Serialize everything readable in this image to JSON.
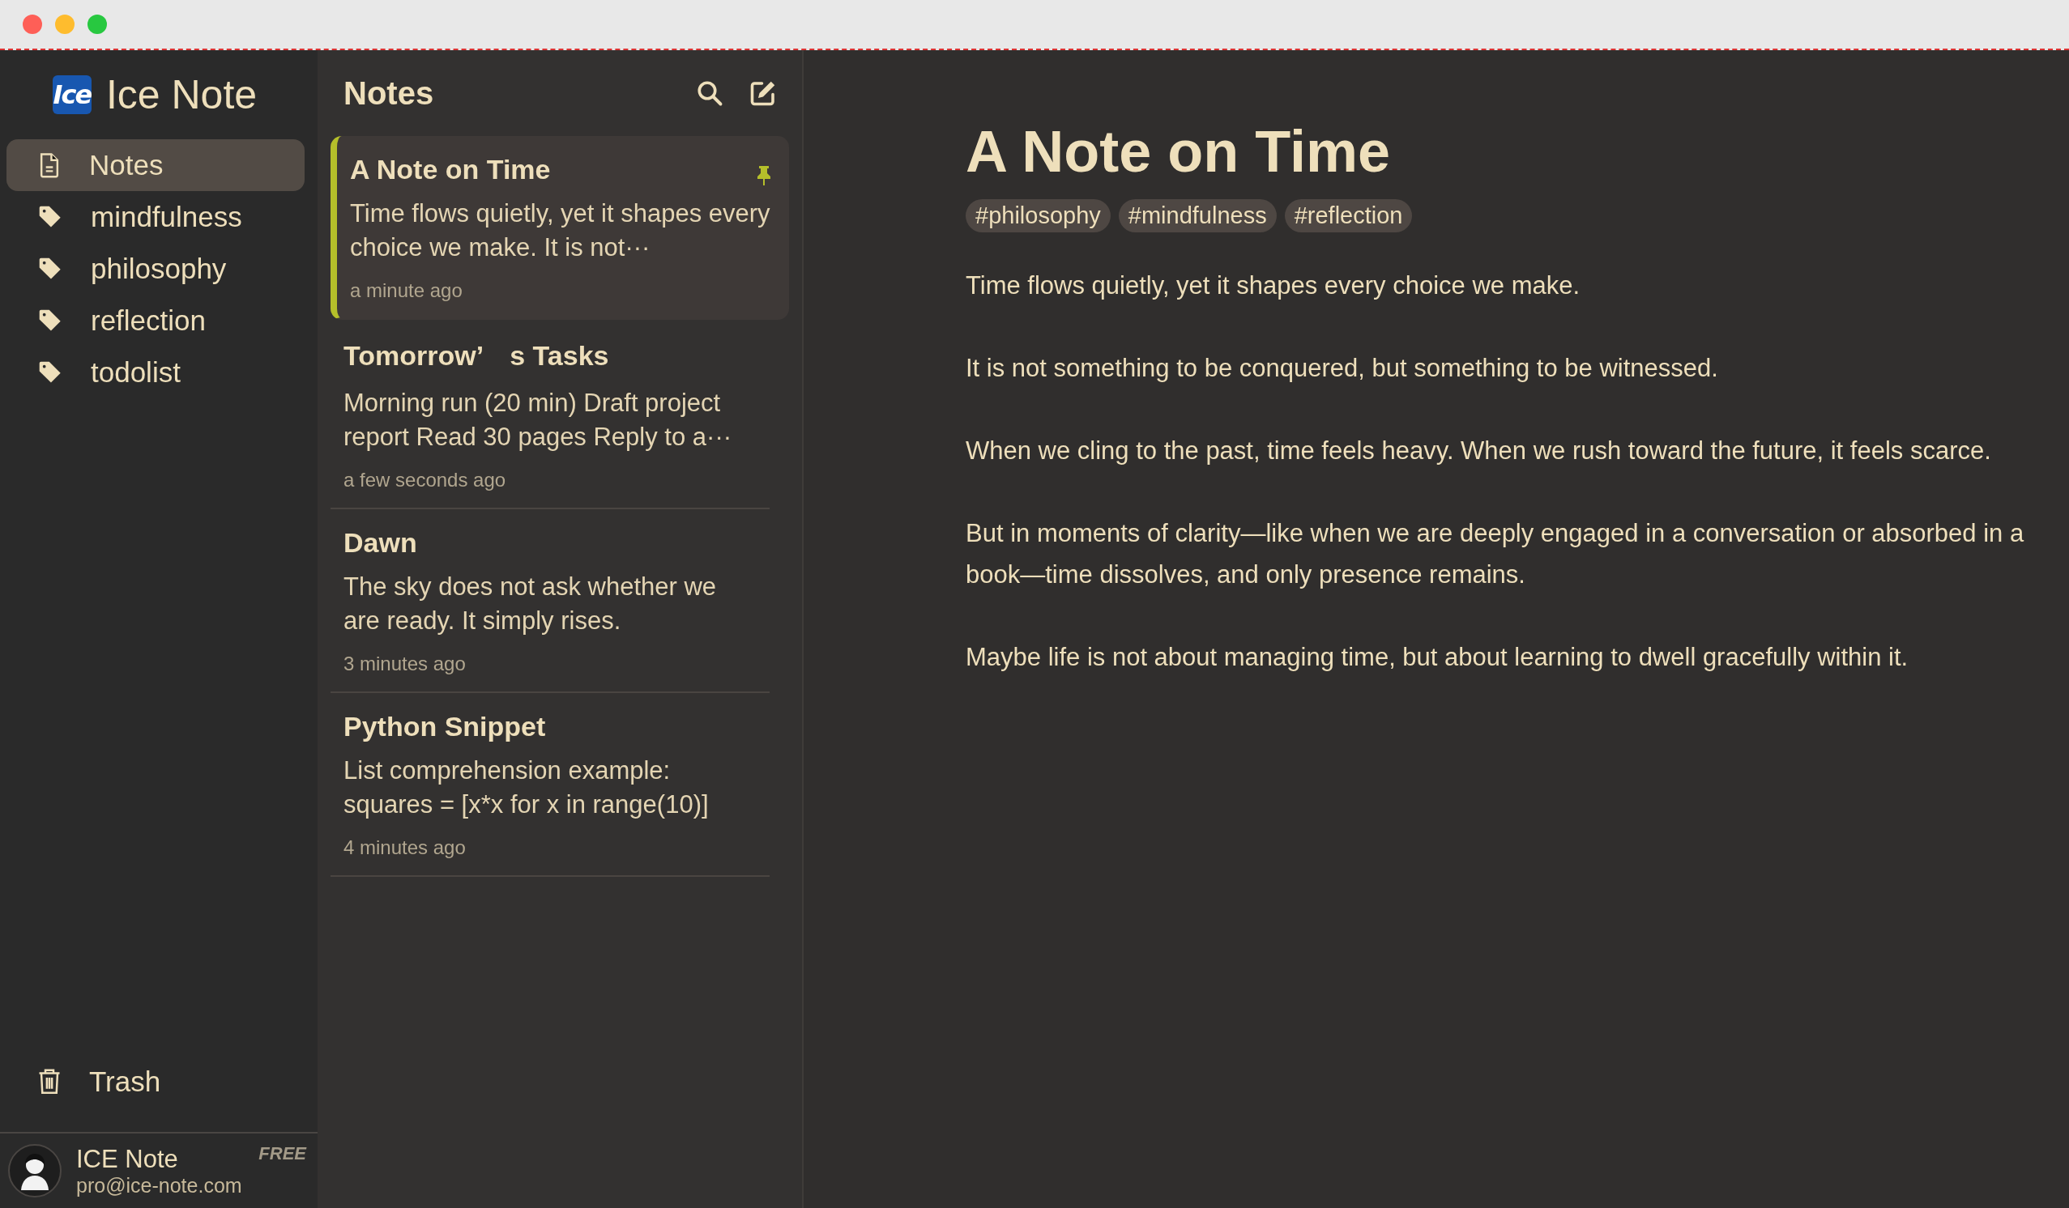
{
  "sidebar": {
    "logo_text": "Ice",
    "app_name": "Ice Note",
    "items": [
      {
        "label": "Notes",
        "kind": "notes",
        "selected": true
      },
      {
        "label": "mindfulness",
        "kind": "tag",
        "selected": false
      },
      {
        "label": "philosophy",
        "kind": "tag",
        "selected": false
      },
      {
        "label": "reflection",
        "kind": "tag",
        "selected": false
      },
      {
        "label": "todolist",
        "kind": "tag",
        "selected": false
      }
    ],
    "trash": {
      "label": "Trash"
    },
    "account": {
      "name": "ICE Note",
      "email": "pro@ice-note.com",
      "plan": "FREE"
    }
  },
  "note_list": {
    "title": "Notes",
    "notes": [
      {
        "title": "A Note on Time",
        "preview": "Time flows quietly, yet it shapes every choice we make. It is not···",
        "time": "a minute ago",
        "selected": true,
        "pinned": true
      },
      {
        "title": "Tomorrow’　s Tasks",
        "preview": "Morning run (20 min) Draft project report Read 30 pages Reply to a···",
        "time": "a few seconds ago",
        "selected": false,
        "pinned": false
      },
      {
        "title": "Dawn",
        "preview": "The sky does not ask whether we are ready. It simply rises.",
        "time": "3 minutes ago",
        "selected": false,
        "pinned": false
      },
      {
        "title": "Python Snippet",
        "preview": "List comprehension example: squares = [x*x for x in range(10)]",
        "time": "4 minutes ago",
        "selected": false,
        "pinned": false
      }
    ]
  },
  "editor": {
    "title": "A Note on Time",
    "tags": [
      "#philosophy",
      "#mindfulness",
      "#reflection"
    ],
    "paragraphs": [
      "Time flows quietly, yet it shapes every choice we make.",
      "It is not something to be conquered, but something to be witnessed.",
      "When we cling to the past, time feels heavy. When we rush toward the future, it feels scarce.",
      "But in moments of clarity—like when we are deeply engaged in a conversation or absorbed in a book—time dissolves, and only presence remains.",
      "Maybe life is not about managing time, but about learning to dwell gracefully within it."
    ]
  }
}
